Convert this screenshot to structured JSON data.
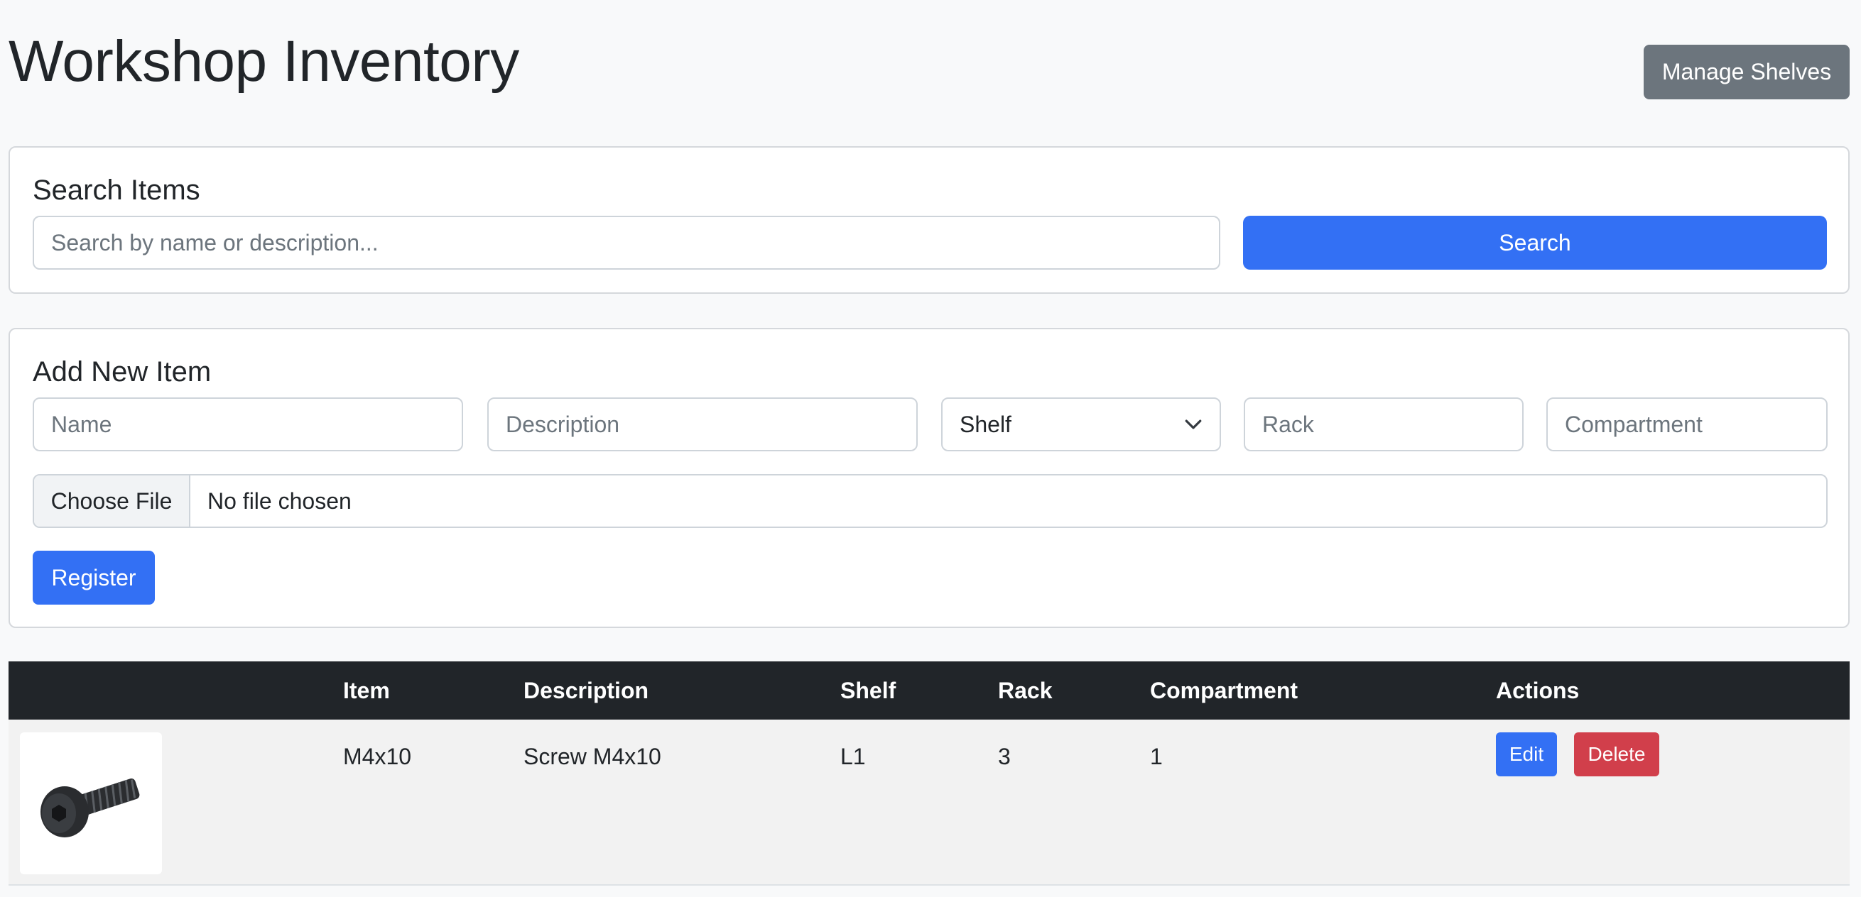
{
  "header": {
    "title": "Workshop Inventory",
    "manage_shelves_label": "Manage Shelves"
  },
  "search": {
    "title": "Search Items",
    "placeholder": "Search by name or description...",
    "button_label": "Search"
  },
  "add_item": {
    "title": "Add New Item",
    "name_placeholder": "Name",
    "description_placeholder": "Description",
    "shelf_selected": "Shelf",
    "rack_placeholder": "Rack",
    "compartment_placeholder": "Compartment",
    "file_button_label": "Choose File",
    "file_status": "No file chosen",
    "register_label": "Register"
  },
  "table": {
    "columns": [
      "",
      "Item",
      "Description",
      "Shelf",
      "Rack",
      "Compartment",
      "Actions"
    ],
    "rows": [
      {
        "image": "screw-image",
        "item": "M4x10",
        "description": "Screw M4x10",
        "shelf": "L1",
        "rack": "3",
        "compartment": "1",
        "edit_label": "Edit",
        "delete_label": "Delete"
      }
    ]
  },
  "colors": {
    "primary": "#3370f4",
    "secondary": "#6c757d",
    "danger": "#d13f4b",
    "table_header": "#212529"
  }
}
